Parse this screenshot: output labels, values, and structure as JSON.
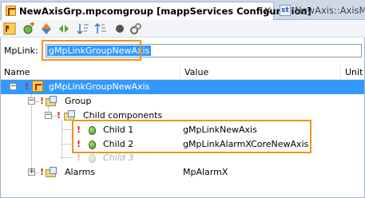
{
  "tabs": [
    {
      "label": "NewAxisGrp.mpcomgroup [mappServices Configuration]",
      "active": true,
      "icon": "config-document-icon",
      "close": "✕"
    },
    {
      "label": "NewAxis::AxisMg",
      "active": false,
      "icon": "structured-text-icon"
    }
  ],
  "toolbar": {
    "buttons": [
      "mplink-toolbar-icon",
      "add-component-icon",
      "move-up-down-icon",
      "expand-icon",
      "sort-down-icon",
      "sort-up-icon",
      "record-icon",
      "settings-icon"
    ]
  },
  "mplink": {
    "label": "MpLink:",
    "value": "gMpLinkGroupNewAxis"
  },
  "columns": {
    "name": "Name",
    "value": "Value",
    "unit": "Unit"
  },
  "tree": {
    "root": {
      "name": "gMpLinkGroupNewAxis",
      "toggle": "−"
    },
    "group": {
      "name": "Group",
      "toggle": "−"
    },
    "child_components": {
      "name": "Child components",
      "toggle": "−"
    },
    "children": [
      {
        "name": "Child 1",
        "value": "gMpLinkNewAxis"
      },
      {
        "name": "Child 2",
        "value": "gMpLinkAlarmXCoreNewAxis"
      },
      {
        "name": "Child 3",
        "value": ""
      }
    ],
    "alarms": {
      "name": "Alarms",
      "value": "MpAlarmX",
      "toggle": "+"
    }
  },
  "colors": {
    "accent_highlight": "#f5911e",
    "selection": "#3399ff",
    "error_marker": "#e02020"
  }
}
